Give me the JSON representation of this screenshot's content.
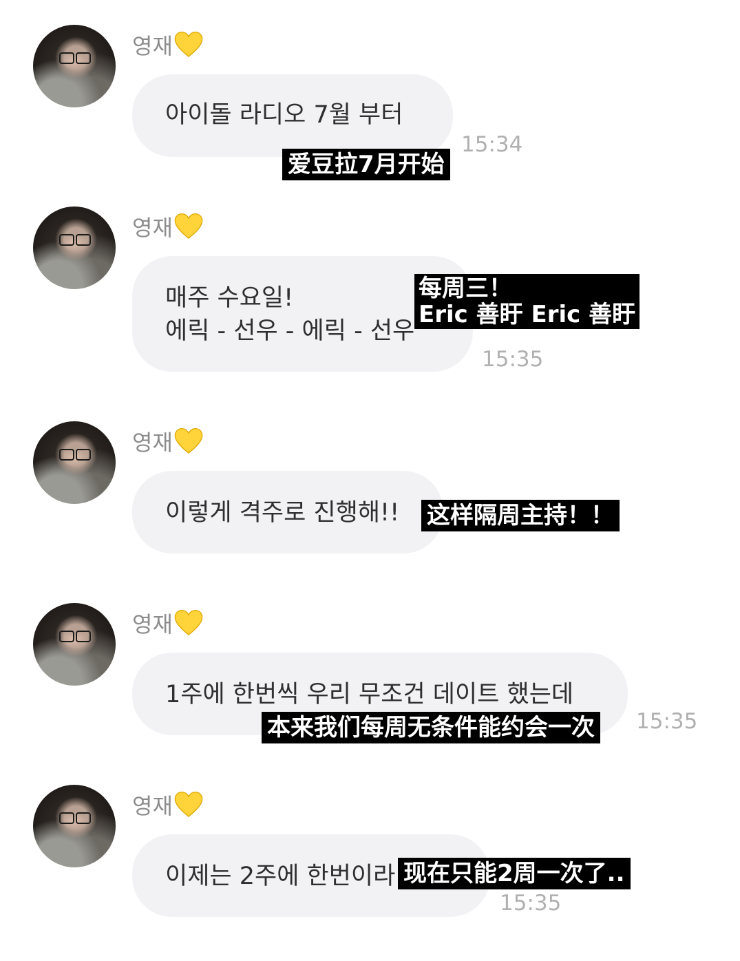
{
  "colors": {
    "bubble": "#f2f2f5",
    "name": "#8c8c8c",
    "time": "#b0b0b0",
    "subtitle_bg": "#000000",
    "heart": "#ffd43b"
  },
  "sender": {
    "name": "영재",
    "avatar_icon": "profile-photo-avatar",
    "emoji_icon": "yellow-heart-icon"
  },
  "messages": [
    {
      "lines": [
        "아이돌 라디오 7월 부터"
      ],
      "time": "15:34",
      "subtitle": [
        "爱豆拉7月开始"
      ]
    },
    {
      "lines": [
        "매주 수요일!",
        "에릭 - 선우 - 에릭 - 선우"
      ],
      "time": "15:35",
      "subtitle": [
        "每周三！",
        "Eric 善盱 Eric 善盱"
      ]
    },
    {
      "lines": [
        "이렇게 격주로 진행해!!"
      ],
      "time": "",
      "subtitle": [
        "这样隔周主持！！"
      ]
    },
    {
      "lines": [
        "1주에 한번씩 우리 무조건 데이트 했는데"
      ],
      "time": "15:35",
      "subtitle": [
        "本来我们每周无条件能约会一次"
      ]
    },
    {
      "lines": [
        "이제는 2주에 한번이라"
      ],
      "time": "15:35",
      "subtitle": [
        "现在只能2周一次了.."
      ]
    }
  ]
}
